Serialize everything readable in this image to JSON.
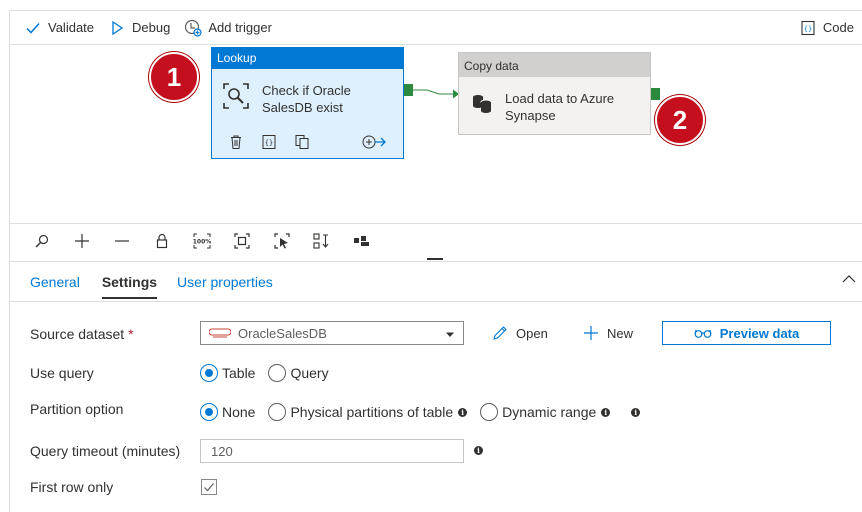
{
  "toolbar": {
    "validate_label": "Validate",
    "debug_label": "Debug",
    "add_trigger_label": "Add trigger",
    "code_label": "Code"
  },
  "canvas": {
    "lookup_activity": {
      "type_label": "Lookup",
      "name": "Check if Oracle SalesDB exist"
    },
    "copy_activity": {
      "type_label": "Copy data",
      "name": "Load data to Azure Synapse"
    },
    "badges": [
      "1",
      "2"
    ]
  },
  "zoom_controls": [
    "search-icon",
    "zoom-in-icon",
    "zoom-out-icon",
    "lock-icon",
    "zoom-100-icon",
    "fit-icon",
    "select-icon",
    "auto-align-icon",
    "layout-icon"
  ],
  "tabs": [
    {
      "label": "General",
      "active": false
    },
    {
      "label": "Settings",
      "active": true
    },
    {
      "label": "User properties",
      "active": false
    }
  ],
  "form": {
    "source_dataset": {
      "label": "Source dataset",
      "required_mark": "*",
      "value": "OracleSalesDB"
    },
    "open_label": "Open",
    "new_label": "New",
    "preview_label": "Preview data",
    "use_query": {
      "label": "Use query",
      "options": [
        "Table",
        "Query"
      ],
      "selected": "Table"
    },
    "partition_option": {
      "label": "Partition option",
      "options": [
        "None",
        "Physical partitions of table",
        "Dynamic range"
      ],
      "selected": "None"
    },
    "query_timeout": {
      "label": "Query timeout (minutes)",
      "value": "120"
    },
    "first_row_only": {
      "label": "First row only",
      "checked": true
    }
  },
  "colors": {
    "accent": "#0078d4",
    "badge": "#c50f1f",
    "success_handle": "#2b8a3e"
  }
}
